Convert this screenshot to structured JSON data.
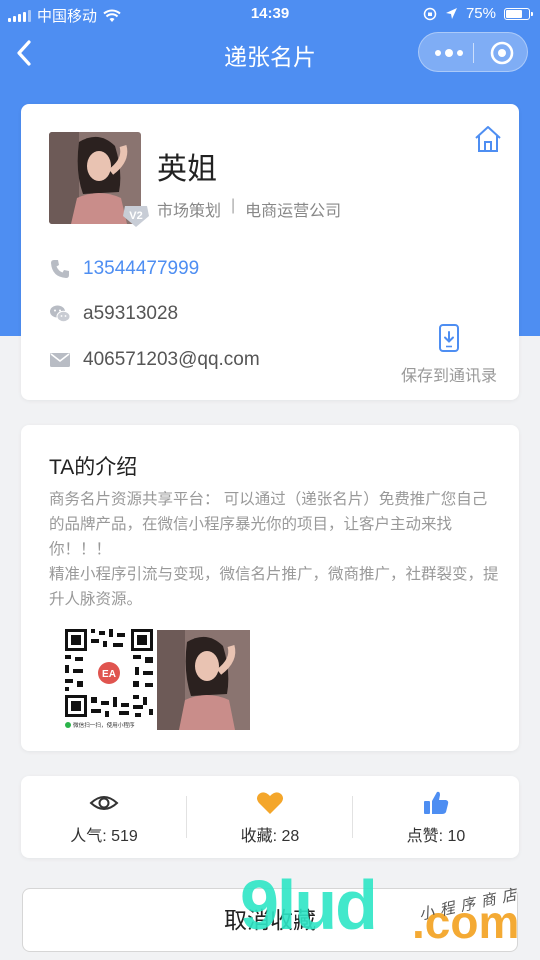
{
  "status_bar": {
    "carrier": "中国移动",
    "time": "14:39",
    "battery": "75%",
    "battery_level": 0.75
  },
  "nav": {
    "title": "递张名片"
  },
  "profile": {
    "name": "英姐",
    "badge": "V2",
    "position": "市场策划",
    "separator": "|",
    "company": "电商运营公司",
    "phone": "13544477999",
    "wechat": "a59313028",
    "email": "406571203@qq.com",
    "save_label": "保存到通讯录"
  },
  "intro": {
    "title": "TA的介绍",
    "paragraphs": [
      "商务名片资源共享平台： 可以通过（递张名片）免费推广您自己的品牌产品，在微信小程序暴光你的项目，让客户主动来找你！！！",
      "精准小程序引流与变现，微信名片推广，微商推广，社群裂变，提升人脉资源。"
    ],
    "qr_caption": "微信扫一扫，使用小程序",
    "qr_logo": "EA"
  },
  "stats": {
    "popularity": "人气: 519",
    "favorites": "收藏: 28",
    "likes": "点赞: 10"
  },
  "actions": {
    "cancel_favorite": "取消收藏"
  },
  "watermark": {
    "main": "9lud",
    "domain": ".com",
    "tagline": "小程序商店"
  },
  "colors": {
    "primary": "#4e8ef2",
    "heart": "#f4a62a",
    "watermark": "#2ee6c6"
  }
}
